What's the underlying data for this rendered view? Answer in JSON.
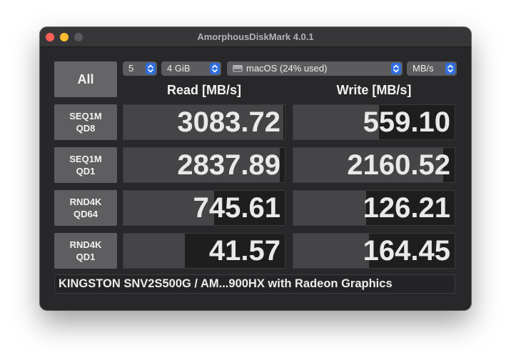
{
  "window": {
    "title": "AmorphousDiskMark 4.0.1"
  },
  "controls": {
    "all_label": "All",
    "count": "5",
    "size": "4 GiB",
    "volume": "macOS (24% used)",
    "unit": "MB/s"
  },
  "headers": {
    "read": "Read [MB/s]",
    "write": "Write [MB/s]"
  },
  "tests": [
    {
      "line1": "SEQ1M",
      "line2": "QD8",
      "read": "3083.72",
      "write": "559.10",
      "read_fraction": 0.99,
      "write_fraction": 0.53
    },
    {
      "line1": "SEQ1M",
      "line2": "QD1",
      "read": "2837.89",
      "write": "2160.52",
      "read_fraction": 0.97,
      "write_fraction": 0.93
    },
    {
      "line1": "RND4K",
      "line2": "QD64",
      "read": "745.61",
      "write": "126.21",
      "read_fraction": 0.56,
      "write_fraction": 0.45
    },
    {
      "line1": "RND4K",
      "line2": "QD1",
      "read": "41.57",
      "write": "164.45",
      "read_fraction": 0.38,
      "write_fraction": 0.47
    }
  ],
  "device_info": "KINGSTON SNV2S500G / AM...900HX with Radeon Graphics",
  "icons": {
    "close": "close-button-icon",
    "minimize": "minimize-button-icon",
    "zoom": "zoom-button-icon",
    "stepper": "stepper-arrows-icon",
    "disk": "disk-icon"
  },
  "colors": {
    "accent": "#2f6fe0",
    "close": "#fe5f57",
    "minimize": "#febc2e"
  }
}
